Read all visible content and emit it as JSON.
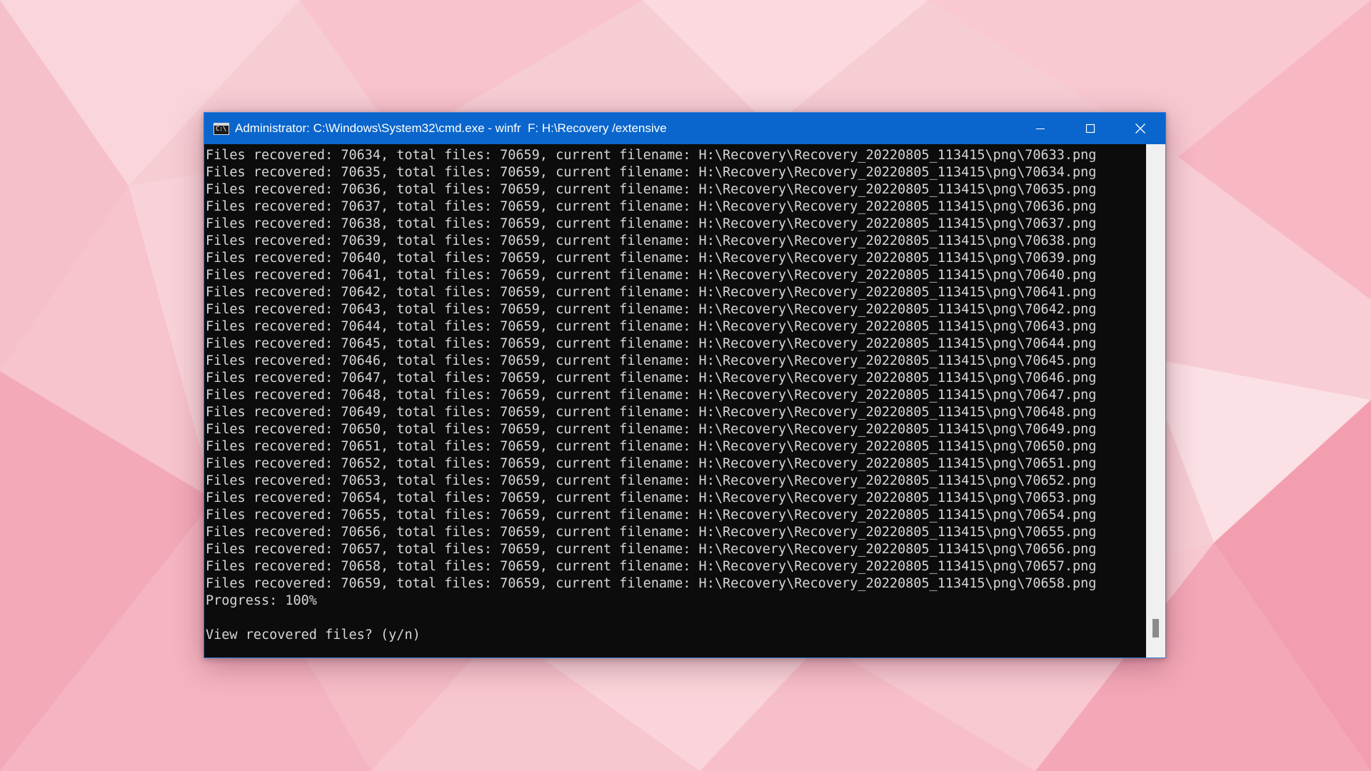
{
  "window": {
    "title": "Administrator: C:\\Windows\\System32\\cmd.exe - winfr  F: H:\\Recovery /extensive",
    "app_icon": "cmd-icon",
    "app_icon_text": "C:\\",
    "controls": {
      "minimize": "minimize-icon",
      "maximize": "maximize-icon",
      "close": "close-icon"
    }
  },
  "console": {
    "lines": [
      "Files recovered: 70634, total files: 70659, current filename: H:\\Recovery\\Recovery_20220805_113415\\png\\70633.png",
      "Files recovered: 70635, total files: 70659, current filename: H:\\Recovery\\Recovery_20220805_113415\\png\\70634.png",
      "Files recovered: 70636, total files: 70659, current filename: H:\\Recovery\\Recovery_20220805_113415\\png\\70635.png",
      "Files recovered: 70637, total files: 70659, current filename: H:\\Recovery\\Recovery_20220805_113415\\png\\70636.png",
      "Files recovered: 70638, total files: 70659, current filename: H:\\Recovery\\Recovery_20220805_113415\\png\\70637.png",
      "Files recovered: 70639, total files: 70659, current filename: H:\\Recovery\\Recovery_20220805_113415\\png\\70638.png",
      "Files recovered: 70640, total files: 70659, current filename: H:\\Recovery\\Recovery_20220805_113415\\png\\70639.png",
      "Files recovered: 70641, total files: 70659, current filename: H:\\Recovery\\Recovery_20220805_113415\\png\\70640.png",
      "Files recovered: 70642, total files: 70659, current filename: H:\\Recovery\\Recovery_20220805_113415\\png\\70641.png",
      "Files recovered: 70643, total files: 70659, current filename: H:\\Recovery\\Recovery_20220805_113415\\png\\70642.png",
      "Files recovered: 70644, total files: 70659, current filename: H:\\Recovery\\Recovery_20220805_113415\\png\\70643.png",
      "Files recovered: 70645, total files: 70659, current filename: H:\\Recovery\\Recovery_20220805_113415\\png\\70644.png",
      "Files recovered: 70646, total files: 70659, current filename: H:\\Recovery\\Recovery_20220805_113415\\png\\70645.png",
      "Files recovered: 70647, total files: 70659, current filename: H:\\Recovery\\Recovery_20220805_113415\\png\\70646.png",
      "Files recovered: 70648, total files: 70659, current filename: H:\\Recovery\\Recovery_20220805_113415\\png\\70647.png",
      "Files recovered: 70649, total files: 70659, current filename: H:\\Recovery\\Recovery_20220805_113415\\png\\70648.png",
      "Files recovered: 70650, total files: 70659, current filename: H:\\Recovery\\Recovery_20220805_113415\\png\\70649.png",
      "Files recovered: 70651, total files: 70659, current filename: H:\\Recovery\\Recovery_20220805_113415\\png\\70650.png",
      "Files recovered: 70652, total files: 70659, current filename: H:\\Recovery\\Recovery_20220805_113415\\png\\70651.png",
      "Files recovered: 70653, total files: 70659, current filename: H:\\Recovery\\Recovery_20220805_113415\\png\\70652.png",
      "Files recovered: 70654, total files: 70659, current filename: H:\\Recovery\\Recovery_20220805_113415\\png\\70653.png",
      "Files recovered: 70655, total files: 70659, current filename: H:\\Recovery\\Recovery_20220805_113415\\png\\70654.png",
      "Files recovered: 70656, total files: 70659, current filename: H:\\Recovery\\Recovery_20220805_113415\\png\\70655.png",
      "Files recovered: 70657, total files: 70659, current filename: H:\\Recovery\\Recovery_20220805_113415\\png\\70656.png",
      "Files recovered: 70658, total files: 70659, current filename: H:\\Recovery\\Recovery_20220805_113415\\png\\70657.png",
      "Files recovered: 70659, total files: 70659, current filename: H:\\Recovery\\Recovery_20220805_113415\\png\\70658.png",
      "Progress: 100%",
      "",
      "View recovered files? (y/n)"
    ]
  },
  "colors": {
    "titlebar": "#0a66cc",
    "console_bg": "#0c0c0c",
    "console_text": "#d6d6d6",
    "scrollbar_bg": "#f0f0f0",
    "scroll_thumb": "#8a8a8a"
  }
}
